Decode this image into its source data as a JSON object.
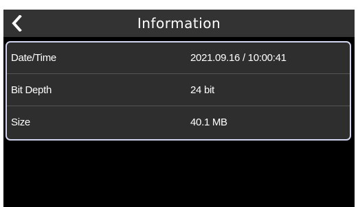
{
  "header": {
    "title": "Information",
    "back_icon": "chevron-left-icon"
  },
  "info": {
    "rows": [
      {
        "label": "Date/Time",
        "value": "2021.09.16 / 10:00:41"
      },
      {
        "label": "Bit Depth",
        "value": "24 bit"
      },
      {
        "label": "Size",
        "value": "40.1 MB"
      }
    ]
  },
  "colors": {
    "header_bg": "#333333",
    "screen_bg": "#000000",
    "panel_bg": "#2e2e2e",
    "panel_border": "#d2d6ee",
    "text": "#ffffff"
  }
}
